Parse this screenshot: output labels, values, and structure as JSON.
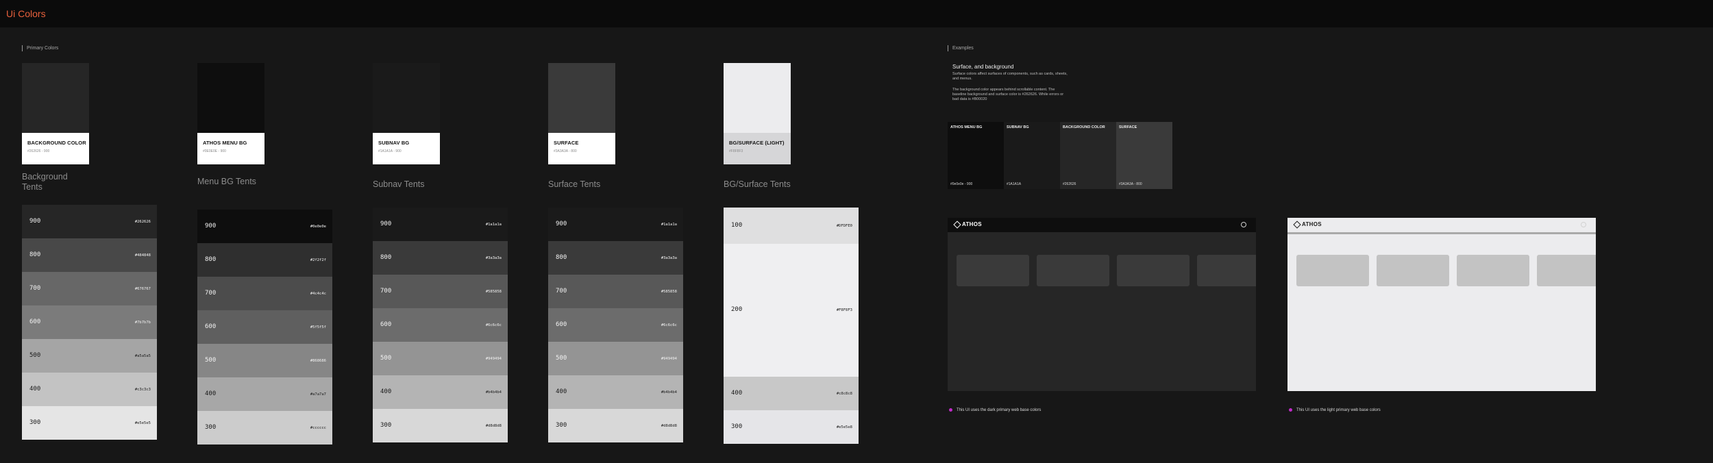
{
  "app": {
    "title": "Ui Colors"
  },
  "primary": {
    "label": "Primary Colors",
    "swatches": [
      {
        "name": "BACKGROUND COLOR",
        "meta": "#262626 - 900",
        "color": "#262626",
        "card_bg": "#ffffff"
      },
      {
        "name": "ATHOS MENU BG",
        "meta": "#0E0E0E - 900",
        "color": "#0e0e0e",
        "card_bg": "#ffffff"
      },
      {
        "name": "SUBNAV BG",
        "meta": "#1A1A1A - 900",
        "color": "#1a1a1a",
        "card_bg": "#ffffff"
      },
      {
        "name": "SURFACE",
        "meta": "#3A3A3A - 800",
        "color": "#3a3a3a",
        "card_bg": "#ffffff"
      },
      {
        "name": "BG/SURFACE (LIGHT)",
        "meta": "#F8F8F3",
        "color": "#ececee",
        "card_bg": "#d6d6d8"
      }
    ]
  },
  "tents": [
    {
      "title": "Background Tents",
      "rows": [
        {
          "level": "900",
          "hex": "#262626",
          "color": "#262626"
        },
        {
          "level": "800",
          "hex": "#484848",
          "color": "#484848"
        },
        {
          "level": "700",
          "hex": "#676767",
          "color": "#676767"
        },
        {
          "level": "600",
          "hex": "#7b7b7b",
          "color": "#7b7b7b"
        },
        {
          "level": "500",
          "hex": "#a5a5a5",
          "color": "#a5a5a5"
        },
        {
          "level": "400",
          "hex": "#c3c3c3",
          "color": "#c3c3c3"
        },
        {
          "level": "300",
          "hex": "#e5e5e5",
          "color": "#e5e5e5"
        }
      ]
    },
    {
      "title": "Menu BG Tents",
      "rows": [
        {
          "level": "900",
          "hex": "#0e0e0e",
          "color": "#0e0e0e"
        },
        {
          "level": "800",
          "hex": "#2f2f2f",
          "color": "#2f2f2f"
        },
        {
          "level": "700",
          "hex": "#4c4c4c",
          "color": "#4c4c4c"
        },
        {
          "level": "600",
          "hex": "#5f5f5f",
          "color": "#5f5f5f"
        },
        {
          "level": "500",
          "hex": "#868686",
          "color": "#868686"
        },
        {
          "level": "400",
          "hex": "#a7a7a7",
          "color": "#a7a7a7"
        },
        {
          "level": "300",
          "hex": "#cccccc",
          "color": "#cccccc"
        }
      ]
    },
    {
      "title": "Subnav Tents",
      "rows": [
        {
          "level": "900",
          "hex": "#1a1a1a",
          "color": "#1a1a1a"
        },
        {
          "level": "800",
          "hex": "#3a3a3a",
          "color": "#3a3a3a"
        },
        {
          "level": "700",
          "hex": "#585858",
          "color": "#585858"
        },
        {
          "level": "600",
          "hex": "#6c6c6c",
          "color": "#6c6c6c"
        },
        {
          "level": "500",
          "hex": "#949494",
          "color": "#949494"
        },
        {
          "level": "400",
          "hex": "#b4b4b4",
          "color": "#b4b4b4"
        },
        {
          "level": "300",
          "hex": "#d8d8d8",
          "color": "#d8d8d8"
        }
      ]
    },
    {
      "title": "Surface Tents",
      "rows": [
        {
          "level": "900",
          "hex": "#1a1a1a",
          "color": "#1a1a1a"
        },
        {
          "level": "800",
          "hex": "#3a3a3a",
          "color": "#3a3a3a"
        },
        {
          "level": "700",
          "hex": "#585858",
          "color": "#585858"
        },
        {
          "level": "600",
          "hex": "#6c6c6c",
          "color": "#6c6c6c"
        },
        {
          "level": "500",
          "hex": "#949494",
          "color": "#949494"
        },
        {
          "level": "400",
          "hex": "#b4b4b4",
          "color": "#b4b4b4"
        },
        {
          "level": "300",
          "hex": "#d8d8d8",
          "color": "#d8d8d8"
        }
      ]
    },
    {
      "title": "BG/Surface Tents",
      "rows": [
        {
          "level": "100",
          "hex": "#DFDFE0",
          "color": "#dfdfe0"
        },
        {
          "level": "200",
          "hex": "#F8F8F3",
          "color": "#efeff1"
        },
        {
          "level": "400",
          "hex": "#c8c8c8",
          "color": "#c8c8c8"
        },
        {
          "level": "300",
          "hex": "#e5e5e8",
          "color": "#e5e5e8"
        }
      ]
    }
  ],
  "examples": {
    "label": "Examples",
    "heading": "Surface, and background",
    "paragraph1": "Surface colors affect surfaces of components, such as cards, sheets, and menus.",
    "paragraph2": "The background color appears behind scrollable content. The baseline background and surface color is #262626. While errors or bad data is #B00020",
    "swatches": [
      {
        "name": "ATHOS MENU BG",
        "hex": "#0e0e0e - 900",
        "color": "#0e0e0e"
      },
      {
        "name": "SUBNAV BG",
        "hex": "#1A1A1A",
        "color": "#1a1a1a"
      },
      {
        "name": "BACKGROUND COLOR",
        "hex": "#262626",
        "color": "#262626"
      },
      {
        "name": "SURFACE",
        "hex": "#3A3A3A - 800",
        "color": "#3a3a3a"
      }
    ],
    "dark_mock": {
      "logo": "ATHOS",
      "caption": "This UI uses the dark primary web base colors"
    },
    "light_mock": {
      "logo": "ATHOS",
      "caption": "This UI uses the light primary web base colors"
    },
    "accent": "#c02bc8"
  }
}
